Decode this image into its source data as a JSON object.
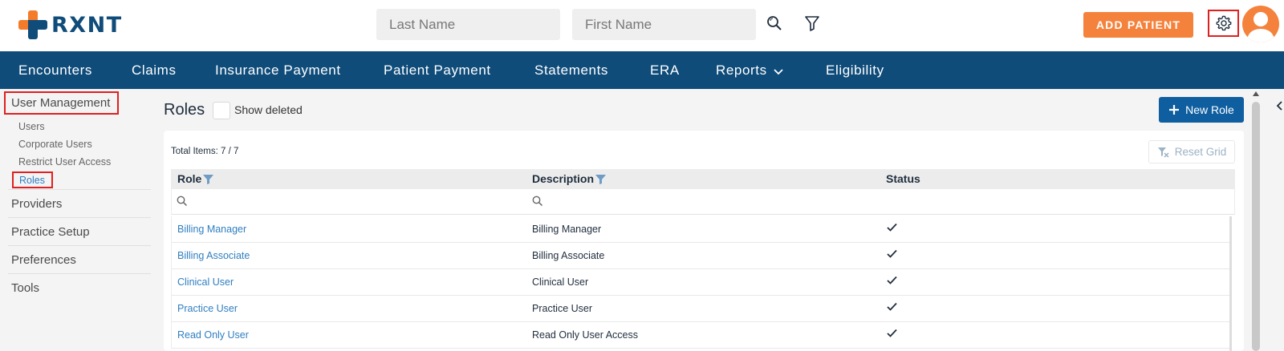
{
  "brand": {
    "name": "RXNT"
  },
  "header": {
    "lastname_placeholder": "Last Name",
    "firstname_placeholder": "First Name",
    "add_patient": "ADD PATIENT"
  },
  "nav": {
    "items": [
      "Encounters",
      "Claims",
      "Insurance Payment",
      "Patient Payment",
      "Statements",
      "ERA",
      "Reports",
      "Eligibility"
    ]
  },
  "sidebar": {
    "user_management": "User Management",
    "sub_items": [
      "Users",
      "Corporate Users",
      "Restrict User Access",
      "Roles"
    ],
    "sections": [
      "Providers",
      "Practice Setup",
      "Preferences",
      "Tools"
    ]
  },
  "main": {
    "title": "Roles",
    "show_deleted": "Show deleted",
    "new_role": "New Role",
    "total_items": "Total Items: 7 / 7",
    "reset_grid": "Reset Grid",
    "columns": [
      "Role",
      "Description",
      "Status"
    ],
    "rows": [
      {
        "role": "Billing Manager",
        "description": "Billing Manager",
        "active": true
      },
      {
        "role": "Billing Associate",
        "description": "Billing Associate",
        "active": true
      },
      {
        "role": "Clinical User",
        "description": "Clinical User",
        "active": true
      },
      {
        "role": "Practice User",
        "description": "Practice User",
        "active": true
      },
      {
        "role": "Read Only User",
        "description": "Read Only User Access",
        "active": true
      }
    ]
  },
  "colors": {
    "brand_blue": "#0f4c7a",
    "accent_orange": "#f4823c",
    "link_blue": "#2f7fc1",
    "highlight_red": "#e02020"
  },
  "icons": [
    "search-icon",
    "filter-icon",
    "gear-icon",
    "user-avatar-icon",
    "chevron-down-icon",
    "plus-icon",
    "filter-clear-icon",
    "checkmark-icon",
    "chevron-left-icon"
  ]
}
